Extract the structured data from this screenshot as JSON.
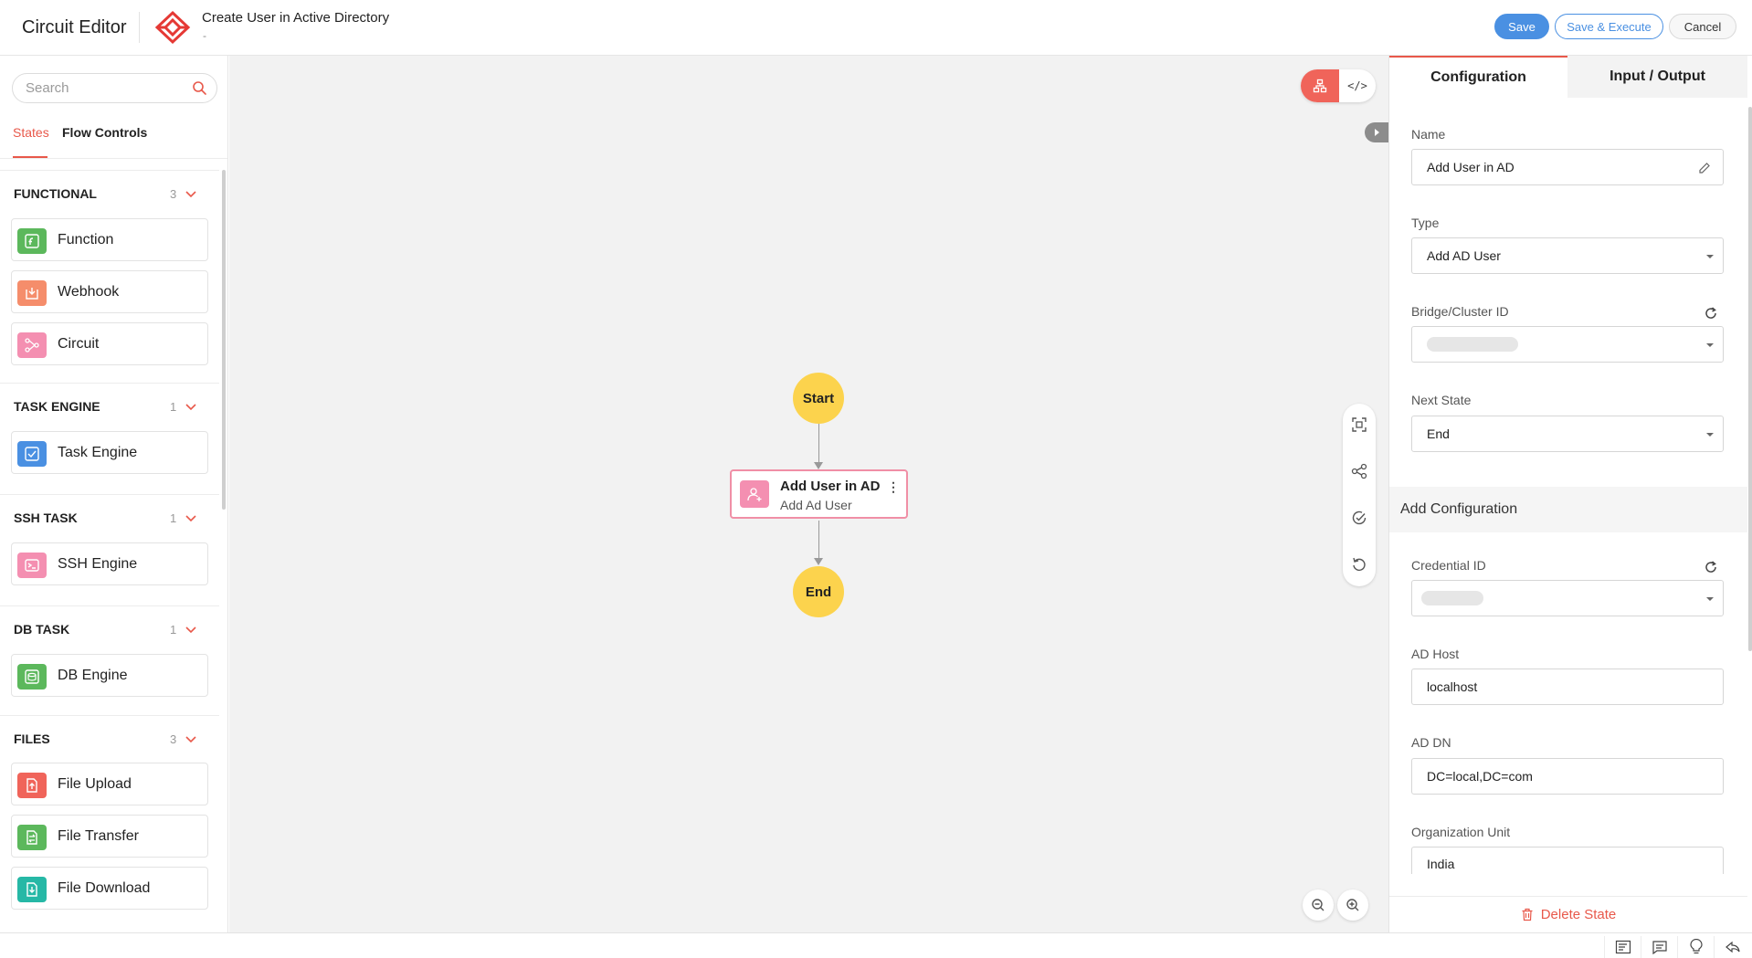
{
  "header": {
    "app_title": "Circuit Editor",
    "circuit_name": "Create User in Active Directory",
    "circuit_description": "-",
    "save_label": "Save",
    "save_execute_label": "Save & Execute",
    "cancel_label": "Cancel"
  },
  "sidebar": {
    "search_placeholder": "Search",
    "tabs": [
      {
        "label": "States",
        "active": true
      },
      {
        "label": "Flow Controls",
        "active": false
      }
    ],
    "categories": [
      {
        "label": "FUNCTIONAL",
        "count": "3",
        "items": [
          {
            "label": "Function",
            "icon": "function-icon",
            "color": "#5cb85c"
          },
          {
            "label": "Webhook",
            "icon": "webhook-icon",
            "color": "#f58d6b"
          },
          {
            "label": "Circuit",
            "icon": "circuit-icon",
            "color": "#f48fb1"
          }
        ]
      },
      {
        "label": "TASK ENGINE",
        "count": "1",
        "items": [
          {
            "label": "Task Engine",
            "icon": "task-engine-icon",
            "color": "#4a90e2"
          }
        ]
      },
      {
        "label": "SSH TASK",
        "count": "1",
        "items": [
          {
            "label": "SSH Engine",
            "icon": "ssh-engine-icon",
            "color": "#f48fb1"
          }
        ]
      },
      {
        "label": "DB TASK",
        "count": "1",
        "items": [
          {
            "label": "DB Engine",
            "icon": "db-engine-icon",
            "color": "#5cb85c"
          }
        ]
      },
      {
        "label": "FILES",
        "count": "3",
        "items": [
          {
            "label": "File Upload",
            "icon": "file-upload-icon",
            "color": "#f0645a"
          },
          {
            "label": "File Transfer",
            "icon": "file-transfer-icon",
            "color": "#5cb85c"
          },
          {
            "label": "File Download",
            "icon": "file-download-icon",
            "color": "#26b8a6"
          }
        ]
      }
    ]
  },
  "canvas": {
    "start_label": "Start",
    "end_label": "End",
    "state_node": {
      "title": "Add User in AD",
      "subtitle": "Add Ad User",
      "menu": "⋮"
    },
    "view_code_label": "</>"
  },
  "panel": {
    "tabs": [
      {
        "label": "Configuration",
        "active": true
      },
      {
        "label": "Input / Output",
        "active": false
      }
    ],
    "fields": {
      "name": {
        "label": "Name",
        "value": "Add User in AD"
      },
      "type": {
        "label": "Type",
        "value": "Add AD User"
      },
      "bridge": {
        "label": "Bridge/Cluster ID",
        "value": ""
      },
      "next_state": {
        "label": "Next State",
        "value": "End"
      }
    },
    "add_config_label": "Add Configuration",
    "config_fields": {
      "credential": {
        "label": "Credential ID",
        "value": ""
      },
      "ad_host": {
        "label": "AD Host",
        "value": "localhost"
      },
      "ad_dn": {
        "label": "AD DN",
        "value": "DC=local,DC=com"
      },
      "org_unit": {
        "label": "Organization Unit",
        "value": "India"
      }
    },
    "delete_label": "Delete State"
  },
  "colors": {
    "accent": "#e8584a",
    "primary": "#4a90e2",
    "node_circle": "#fcd34d",
    "node_border": "#f08fa6"
  }
}
